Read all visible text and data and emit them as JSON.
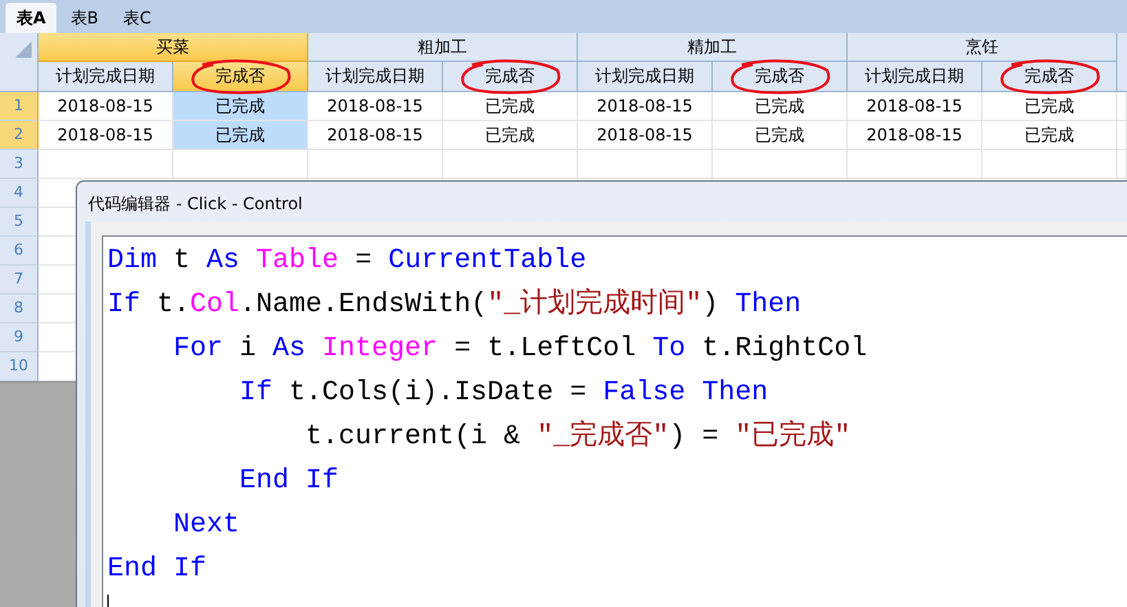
{
  "tabs": [
    {
      "label": "表A",
      "selected": true
    },
    {
      "label": "表B",
      "selected": false
    },
    {
      "label": "表C",
      "selected": false
    }
  ],
  "groups": [
    {
      "name": "买菜",
      "selected": true,
      "columns": [
        {
          "label": "计划完成日期",
          "selected": false,
          "circled": false
        },
        {
          "label": "完成否",
          "selected": true,
          "circled": true
        }
      ]
    },
    {
      "name": "粗加工",
      "selected": false,
      "columns": [
        {
          "label": "计划完成日期",
          "selected": false,
          "circled": false
        },
        {
          "label": "完成否",
          "selected": false,
          "circled": true
        }
      ]
    },
    {
      "name": "精加工",
      "selected": false,
      "columns": [
        {
          "label": "计划完成日期",
          "selected": false,
          "circled": false
        },
        {
          "label": "完成否",
          "selected": false,
          "circled": true
        }
      ]
    },
    {
      "name": "烹饪",
      "selected": false,
      "columns": [
        {
          "label": "计划完成日期",
          "selected": false,
          "circled": false
        },
        {
          "label": "完成否",
          "selected": false,
          "circled": true
        }
      ]
    }
  ],
  "rows": [
    {
      "number": "1",
      "selected": true,
      "cells": [
        {
          "text": "2018-08-15",
          "selected": false
        },
        {
          "text": "已完成",
          "selected": true
        },
        {
          "text": "2018-08-15",
          "selected": false
        },
        {
          "text": "已完成",
          "selected": false
        },
        {
          "text": "2018-08-15",
          "selected": false
        },
        {
          "text": "已完成",
          "selected": false
        },
        {
          "text": "2018-08-15",
          "selected": false
        },
        {
          "text": "已完成",
          "selected": false
        }
      ]
    },
    {
      "number": "2",
      "selected": true,
      "cells": [
        {
          "text": "2018-08-15",
          "selected": false
        },
        {
          "text": "已完成",
          "selected": true
        },
        {
          "text": "2018-08-15",
          "selected": false
        },
        {
          "text": "已完成",
          "selected": false
        },
        {
          "text": "2018-08-15",
          "selected": false
        },
        {
          "text": "已完成",
          "selected": false
        },
        {
          "text": "2018-08-15",
          "selected": false
        },
        {
          "text": "已完成",
          "selected": false
        }
      ]
    },
    {
      "number": "3",
      "selected": false
    },
    {
      "number": "4",
      "selected": false
    },
    {
      "number": "5",
      "selected": false
    },
    {
      "number": "6",
      "selected": false
    },
    {
      "number": "7",
      "selected": false
    },
    {
      "number": "8",
      "selected": false
    },
    {
      "number": "9",
      "selected": false
    },
    {
      "number": "10",
      "selected": false
    }
  ],
  "editor": {
    "title": "代码编辑器 - Click - Control",
    "lines": [
      [
        {
          "kind": "keyword",
          "text": "Dim"
        },
        {
          "kind": "plain",
          "text": " t "
        },
        {
          "kind": "keyword",
          "text": "As"
        },
        {
          "kind": "type",
          "text": " Table"
        },
        {
          "kind": "plain",
          "text": " = "
        },
        {
          "kind": "keyword",
          "text": "CurrentTable"
        }
      ],
      [
        {
          "kind": "keyword",
          "text": "If"
        },
        {
          "kind": "plain",
          "text": " t."
        },
        {
          "kind": "type",
          "text": "Col"
        },
        {
          "kind": "plain",
          "text": ".Name.EndsWith("
        },
        {
          "kind": "string",
          "text": "\"_计划完成时间\""
        },
        {
          "kind": "plain",
          "text": ") "
        },
        {
          "kind": "keyword",
          "text": "Then"
        }
      ],
      [
        {
          "kind": "keyword",
          "text": "    For"
        },
        {
          "kind": "plain",
          "text": " i "
        },
        {
          "kind": "keyword",
          "text": "As"
        },
        {
          "kind": "type",
          "text": " Integer"
        },
        {
          "kind": "plain",
          "text": " = t.LeftCol "
        },
        {
          "kind": "keyword",
          "text": "To"
        },
        {
          "kind": "plain",
          "text": " t.RightCol"
        }
      ],
      [
        {
          "kind": "keyword",
          "text": "        If"
        },
        {
          "kind": "plain",
          "text": " t.Cols(i).IsDate = "
        },
        {
          "kind": "keyword",
          "text": "False Then"
        }
      ],
      [
        {
          "kind": "plain",
          "text": "            t.current(i & "
        },
        {
          "kind": "string",
          "text": "\"_完成否\""
        },
        {
          "kind": "plain",
          "text": ") = "
        },
        {
          "kind": "string",
          "text": "\"已完成\""
        }
      ],
      [
        {
          "kind": "keyword",
          "text": "        End If"
        }
      ],
      [
        {
          "kind": "keyword",
          "text": "    Next"
        }
      ],
      [
        {
          "kind": "keyword",
          "text": "End If"
        }
      ]
    ]
  }
}
